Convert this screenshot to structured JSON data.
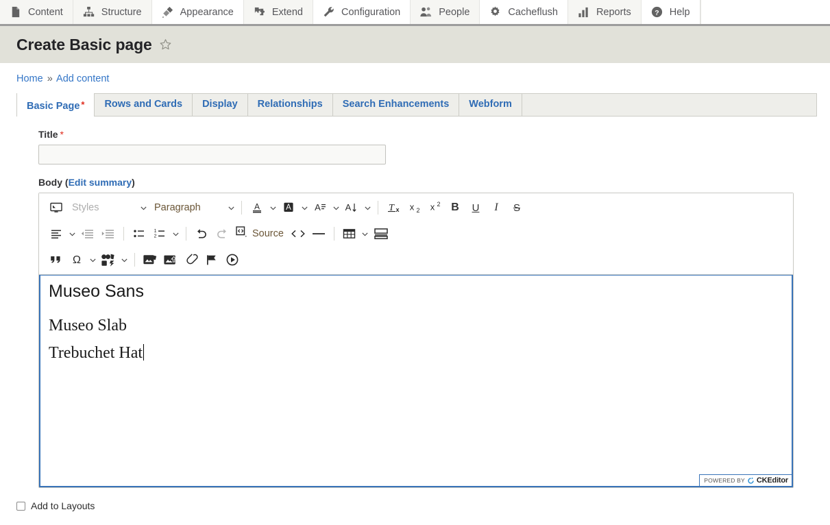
{
  "admin_toolbar": {
    "items": [
      {
        "label": "Content",
        "icon": "document-icon"
      },
      {
        "label": "Structure",
        "icon": "structure-icon"
      },
      {
        "label": "Appearance",
        "icon": "paintbrush-icon"
      },
      {
        "label": "Extend",
        "icon": "puzzle-icon"
      },
      {
        "label": "Configuration",
        "icon": "wrench-icon"
      },
      {
        "label": "People",
        "icon": "people-icon"
      },
      {
        "label": "Cacheflush",
        "icon": "gear-icon"
      },
      {
        "label": "Reports",
        "icon": "bar-chart-icon"
      },
      {
        "label": "Help",
        "icon": "help-circle-icon"
      }
    ]
  },
  "header": {
    "page_title": "Create Basic page",
    "star_icon": "star-outline-icon"
  },
  "breadcrumb": {
    "home": "Home",
    "separator": "»",
    "current": "Add content"
  },
  "tabs": [
    {
      "label": "Basic Page",
      "required": "*",
      "active": true
    },
    {
      "label": "Rows and Cards",
      "active": false
    },
    {
      "label": "Display",
      "active": false
    },
    {
      "label": "Relationships",
      "active": false
    },
    {
      "label": "Search Enhancements",
      "active": false
    },
    {
      "label": "Webform",
      "active": false
    }
  ],
  "form": {
    "title_field": {
      "label": "Title",
      "required_mark": "*",
      "value": "",
      "placeholder": ""
    },
    "body_field": {
      "label": "Body",
      "edit_summary_open": "(",
      "edit_summary_link": "Edit summary",
      "edit_summary_close": ")"
    }
  },
  "editor": {
    "toolbar_row1": {
      "maximize": "maximize-icon",
      "styles_label": "Styles",
      "paragraph_label": "Paragraph",
      "font_color": "font-color-icon",
      "background_color": "background-color-icon",
      "font_family": "font-family-icon",
      "font_size": "font-size-icon",
      "remove_format": "remove-format-icon",
      "subscript": "subscript-icon",
      "superscript": "superscript-icon",
      "bold": "B",
      "underline": "U",
      "italic": "I",
      "strikethrough": "S"
    },
    "toolbar_row2": {
      "align": "align-left-icon",
      "outdent": "outdent-icon",
      "indent": "indent-icon",
      "bulleted_list": "bulleted-list-icon",
      "numbered_list": "numbered-list-icon",
      "undo": "undo-icon",
      "redo": "redo-icon",
      "source_label": "Source",
      "code": "code-icon",
      "horizontal_line": "horizontal-line-icon",
      "table": "table-icon",
      "page_break": "page-break-icon"
    },
    "toolbar_row3": {
      "blockquote": "blockquote-icon",
      "special_character": "special-character-icon",
      "media_library": "media-library-icon",
      "media_browser": "media-browser-icon",
      "image_upload": "image-upload-icon",
      "link": "link-icon",
      "anchor": "anchor-flag-icon",
      "video": "video-icon"
    },
    "content_lines": [
      "Museo Sans",
      "Museo Slab",
      "Trebuchet Hat"
    ],
    "badge": {
      "powered_by": "POWERED BY",
      "brand": "CKEditor",
      "logo": "ckeditor-logo-icon"
    }
  },
  "bottom": {
    "add_to_layouts_label": "Add to Layouts",
    "checked": false
  },
  "colors": {
    "link": "#2f6cb5",
    "required": "#e02b1d",
    "title_band": "#e1e1d9",
    "editor_focus_border": "#3873b8",
    "toolbar_text": "#56565a"
  }
}
